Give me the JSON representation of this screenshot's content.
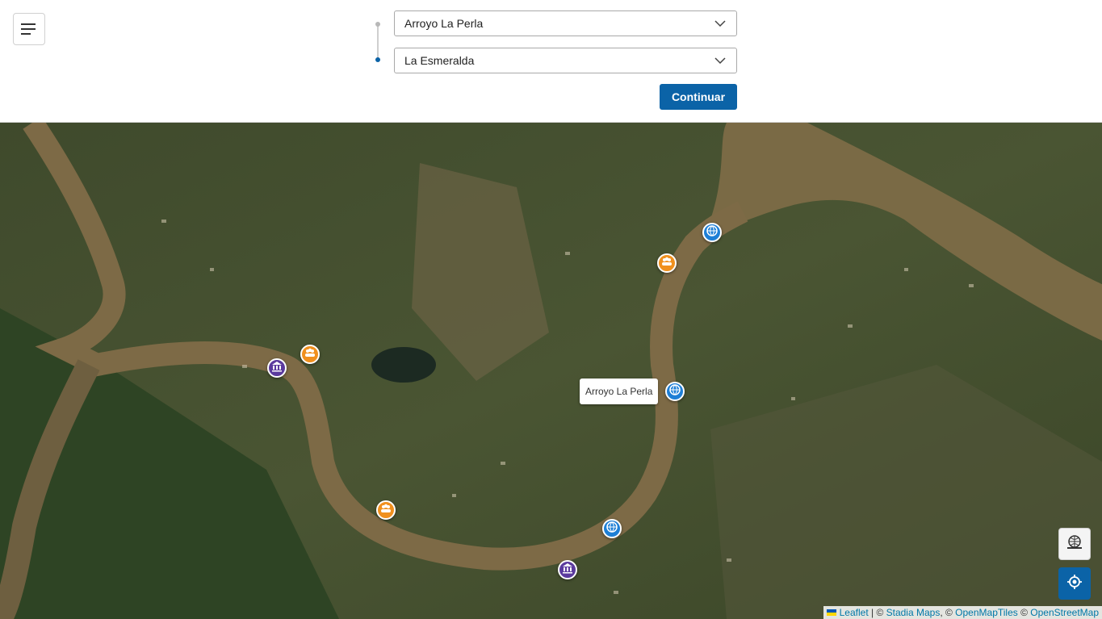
{
  "header": {
    "menu_icon": "hamburger-icon",
    "origin": {
      "value": "Arroyo La Perla"
    },
    "destination": {
      "value": "La Esmeralda"
    },
    "continue_label": "Continuar"
  },
  "map": {
    "markers": [
      {
        "type": "blue",
        "icon": "globe-icon"
      },
      {
        "type": "orange",
        "icon": "group-icon"
      },
      {
        "type": "orange",
        "icon": "group-icon"
      },
      {
        "type": "purple",
        "icon": "museum-icon"
      },
      {
        "type": "blue",
        "icon": "globe-icon"
      },
      {
        "type": "orange",
        "icon": "group-icon"
      },
      {
        "type": "blue",
        "icon": "globe-icon"
      },
      {
        "type": "purple",
        "icon": "museum-icon"
      }
    ],
    "tooltip": "Arroyo La Perla",
    "controls": {
      "layers_icon": "layers-icon",
      "locate_icon": "locate-icon"
    },
    "attribution": {
      "leaflet": "Leaflet",
      "sep1": " | © ",
      "stadia": "Stadia Maps",
      "sep2": ", © ",
      "omt": "OpenMapTiles",
      "sep3": " © ",
      "osm": "OpenStreetMap"
    }
  },
  "colors": {
    "primary": "#0b63a7",
    "orange": "#f0901e",
    "blue": "#1e7fd6",
    "purple": "#5b3a9e"
  }
}
